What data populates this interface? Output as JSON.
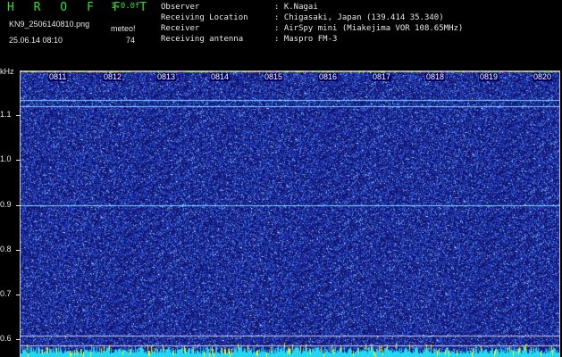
{
  "header": {
    "brand": "H R O F F T",
    "version": "1.0.0f",
    "filename": "KN9_2506140810.png",
    "meteo": "meteo!",
    "datetime": "25.06.14 08:10",
    "count": "74",
    "meta": [
      {
        "label": "Observer",
        "value": ": K.Nagai"
      },
      {
        "label": "Receiving Location",
        "value": ": Chigasaki, Japan (139.414 35.340)"
      },
      {
        "label": "Receiver",
        "value": ": AirSpy mini (Miakejima VOR 108.65MHz)"
      },
      {
        "label": "Receiving antenna",
        "value": ": Maspro FM-3"
      }
    ]
  },
  "spectrogram": {
    "y_unit": "kHz",
    "y_ticks": [
      "1.1",
      "1.0",
      "0.9",
      "0.8",
      "0.7",
      "0.6"
    ],
    "y_range_khz": [
      0.58,
      1.17
    ],
    "x_ticks": [
      "0811",
      "0812",
      "0813",
      "0814",
      "0815",
      "0816",
      "0817",
      "0818",
      "0819",
      "0820"
    ],
    "carrier_lines_khz": [
      1.11,
      1.097,
      0.893,
      0.625,
      0.603
    ],
    "colors": {
      "background": "#14146e",
      "noise": "#3a6adf",
      "line": "#7fd8ff",
      "baseline": "#20d8f0",
      "yellow": "#f0f020"
    }
  }
}
